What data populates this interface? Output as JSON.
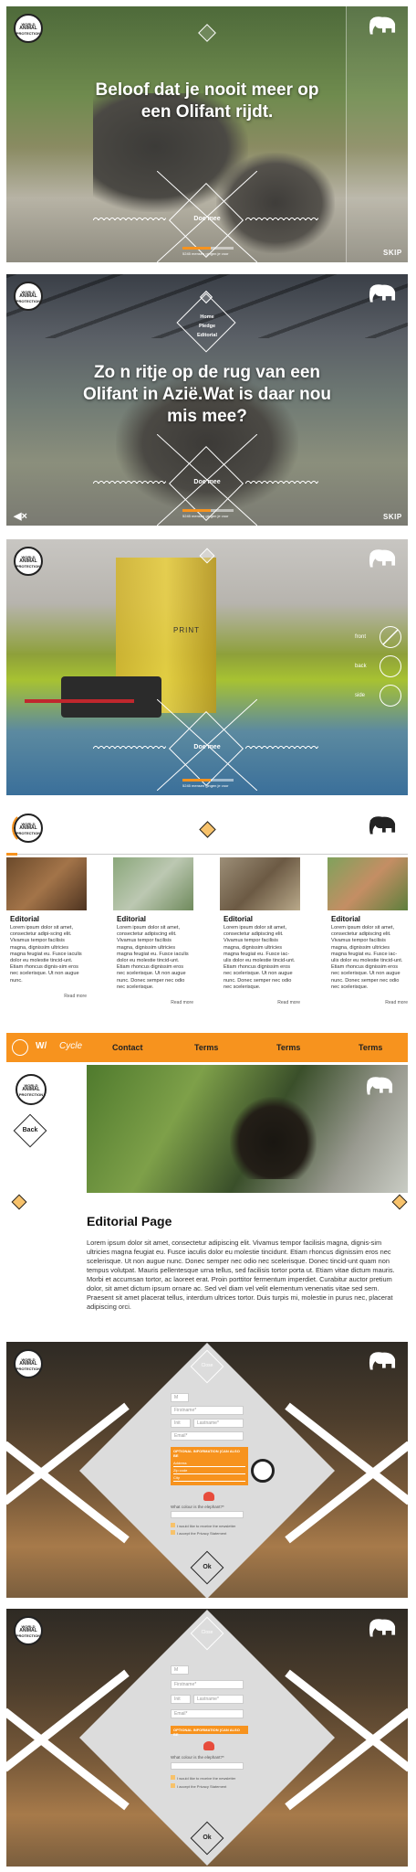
{
  "brand": {
    "logo_lines": [
      "WORLD",
      "ANIMAL",
      "PROTECTION"
    ]
  },
  "screen1": {
    "title_line1": "Beloof dat je nooit meer op",
    "title_line2": "een Olifant rijdt.",
    "cta": "Doe mee",
    "progress_text": "5245 mensen gingen je voor",
    "progress": 0.55,
    "skip": "SKIP"
  },
  "screen2": {
    "menu": [
      "Home",
      "Pledge",
      "Editorial"
    ],
    "title_line1": "Zo n ritje op de rug van een",
    "title_line2": "Olifant in Azië.Wat is daar nou",
    "title_line3": "mis mee?",
    "cta": "Doe mee",
    "progress_text": "5245 mensen gingen je voor",
    "progress": 0.55,
    "skip": "SKIP",
    "mute_icon": "speaker-mute-icon"
  },
  "screen3": {
    "side_labels": [
      "front",
      "back",
      "side"
    ],
    "watermark": "PRINT",
    "cta": "Doe mee",
    "progress_text": "5245 mensen gingen je voor",
    "progress": 0.55
  },
  "editorial_list": {
    "cards": [
      {
        "title": "Editorial",
        "body": "Lorem ipsum dolor sit amet, consectetur adipi-scing elit. Vivamus tempor facilisis magna, dignissim ultricies magna feugiat eu. Fusce iaculis dolor eu molestie tincid-unt. Etiam rhoncus dignis-sim eros nec scelerisque. Ut non augue nunc.",
        "more": "Read more"
      },
      {
        "title": "Editorial",
        "body": "Lorem ipsum dolor sit amet, consectetur adipiscing elit. Vivamus tempor facilisis magna, dignissim ultricies magna feugiat eu. Fusce iaculis dolor eu molestie tincid-unt. Etiam rhoncus dignissim eros nec scelerisque. Ut non augue nunc. Donec semper nec odio nec scelerisque.",
        "more": "Read more"
      },
      {
        "title": "Editorial",
        "body": "Lorem ipsum dolor sit amet, consectetur adipiscing elit. Vivamus tempor facilisis magna, dignissim ultricies magna feugiat eu. Fusce iac-ulis dolor eu molestie tincid-unt. Etiam rhoncus dignissim eros nec scelerisque. Ut non augue nunc. Donec semper nec odio nec scelerisque.",
        "more": "Read more"
      },
      {
        "title": "Editorial",
        "body": "Lorem ipsum dolor sit amet, consectetur adipiscing elit. Vivamus tempor facilisis magna, dignissim ultricies magna feugiat eu. Fusce iac-ulis dolor eu molestie tincid-unt. Etiam rhoncus dignissim eros nec scelerisque. Ut non augue nunc. Donec semper nec odio nec scelerisque.",
        "more": "Read more"
      }
    ]
  },
  "nav": {
    "items": [
      "Contact",
      "Terms",
      "Terms",
      "Terms"
    ],
    "accent": "#f7931e"
  },
  "editorial_page": {
    "back": "Back",
    "title": "Editorial Page",
    "body": "Lorem ipsum dolor sit amet, consectetur adipiscing elit. Vivamus tempor facilisis magna, dignis-sim ultricies magna feugiat eu. Fusce iaculis dolor eu molestie tincidunt. Etiam rhoncus dignissim eros nec scelerisque. Ut non augue nunc. Donec semper nec odio nec scelerisque. Donec tincid-unt quam non tempus volutpat. Mauris pellentesque urna tellus, sed facilisis tortor porta ut. Etiam vitae dictum mauris. Morbi et accumsan tortor, ac laoreet erat. Proin porttitor fermentum imperdiet. Curabitur auctor pretium dolor, sit amet dictum ipsum ornare ac. Sed vel diam vel velit elementum venenatis vitae sed sem. Praesent sit amet placerat tellus, interdum ultrices tortor. Duis turpis mi, molestie in purus nec, placerat adipiscing orci."
  },
  "form1": {
    "close": "Close",
    "salutation": "M",
    "first_name": "Firstname*",
    "initials": "Init",
    "last_name": "Lastname*",
    "email": "Email*",
    "section": "OPTIONAL INFORMATION (CAN ALSO BE",
    "address_fields": [
      "Address",
      "Zip code",
      "City"
    ],
    "question": "What colour is the elephant?*",
    "checkbox1": "I would like to receive the newsletter",
    "checkbox2": "I accept the Privacy Statement",
    "ok": "Ok"
  },
  "form2": {
    "close": "Close",
    "salutation": "M",
    "first_name": "Firstname*",
    "initials": "Init",
    "last_name": "Lastname*",
    "email": "Email*",
    "section": "OPTIONAL INFORMATION (CAN ALSO BE",
    "question": "What colour is the elephant?*",
    "checkbox1": "I would like to receive the newsletter",
    "checkbox2": "I accept the Privacy Statement",
    "ok": "Ok"
  }
}
